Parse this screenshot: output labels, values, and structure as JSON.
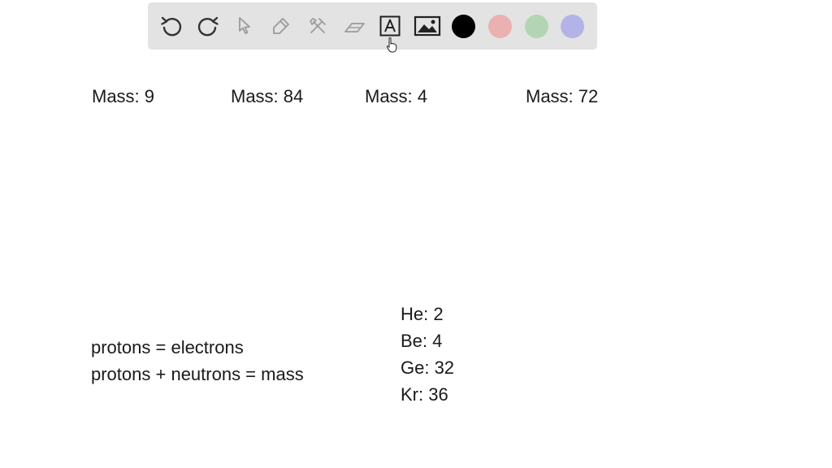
{
  "toolbar": {
    "tools": [
      "undo-icon",
      "redo-icon",
      "select-arrow-icon",
      "pen-icon",
      "tools-icon",
      "eraser-icon",
      "text-box-icon",
      "image-icon"
    ],
    "colors": {
      "black": "#000000",
      "red": "#ebb1b1",
      "green": "#b3d5b3",
      "blue": "#b3b3e8"
    }
  },
  "masses": {
    "m1": "Mass: 9",
    "m2": "Mass: 84",
    "m3": "Mass: 4",
    "m4": "Mass: 72"
  },
  "notes": {
    "line1": "protons = electrons",
    "line2": "protons + neutrons = mass"
  },
  "elements": {
    "he": "He: 2",
    "be": "Be: 4",
    "ge": "Ge: 32",
    "kr": "Kr: 36"
  }
}
